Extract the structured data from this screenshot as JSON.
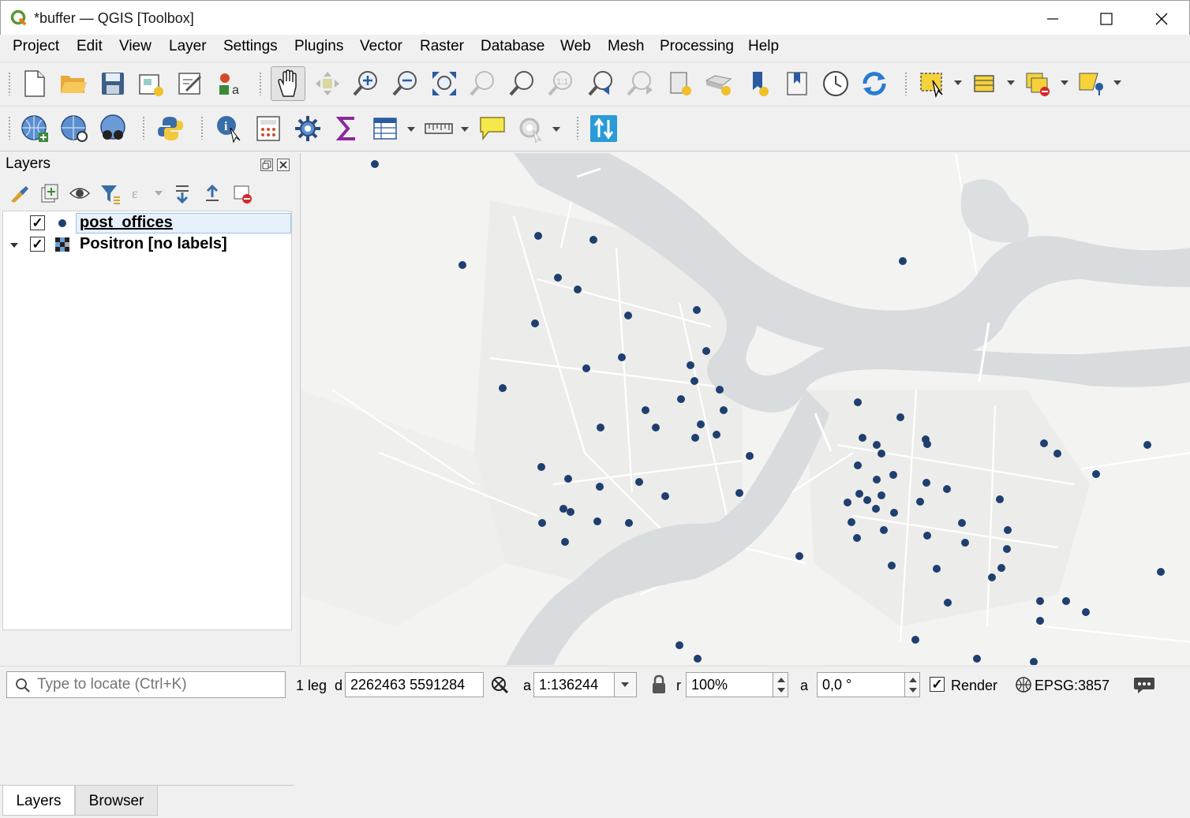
{
  "window": {
    "title": "*buffer — QGIS [Toolbox]"
  },
  "menu": [
    "Project",
    "Edit",
    "View",
    "Layer",
    "Settings",
    "Plugins",
    "Vector",
    "Raster",
    "Database",
    "Web",
    "Mesh",
    "Processing",
    "Help"
  ],
  "toolbar_icons": {
    "row1": [
      "new-project-icon",
      "open-project-icon",
      "save-project-icon",
      "new-print-layout-icon",
      "layout-manager-icon",
      "style-manager-icon",
      "pan-map-icon",
      "pan-to-selection-icon",
      "zoom-in-icon",
      "zoom-out-icon",
      "zoom-full-icon",
      "zoom-to-selection-icon",
      "zoom-to-layer-icon",
      "zoom-native-icon",
      "zoom-last-icon",
      "zoom-next-icon",
      "new-bookmark-icon",
      "show-bookmarks-icon",
      "new-map-view-icon",
      "new-3d-view-icon",
      "temporal-controller-icon",
      "refresh-icon",
      "select-features-icon",
      "open-attribute-table-icon",
      "deselect-features-icon",
      "select-by-location-icon"
    ],
    "row2": [
      "add-wms-layer-icon",
      "metasearch-icon",
      "ogr-layer-icon",
      "python-console-icon",
      "identify-features-icon",
      "field-calculator-icon",
      "processing-toolbox-icon",
      "statistics-sum-icon",
      "attribute-table-icon",
      "measure-line-icon",
      "map-tips-icon",
      "digitizing-icon",
      "quickmapservices-icon"
    ]
  },
  "layers_panel": {
    "title": "Layers",
    "layers": [
      {
        "name": "post_offices",
        "checked": "✓",
        "icon": "point-symbol-icon",
        "selected": true
      },
      {
        "name": "Positron [no labels]",
        "checked": "✓",
        "icon": "raster-tile-icon",
        "expanded": true
      }
    ],
    "tabs": [
      "Layers",
      "Browser"
    ]
  },
  "map": {
    "basemap": "Positron [no labels]",
    "point_color": "#1f3f6f",
    "water_color": "#d8dcde",
    "land_color": "#f3f3f1"
  },
  "statusbar": {
    "locator_placeholder": "Type to locate (Ctrl+K)",
    "legend_text": "1 leg",
    "coord_label": "d",
    "coordinate": "2262463  5591284",
    "scale_label": "a",
    "scale": "1:136244",
    "magnifier_label": "r",
    "magnifier": "100%",
    "rotation_label": "a",
    "rotation": "0,0 °",
    "render_label": "Render",
    "render_checked": "✓",
    "crs": "EPSG:3857"
  }
}
